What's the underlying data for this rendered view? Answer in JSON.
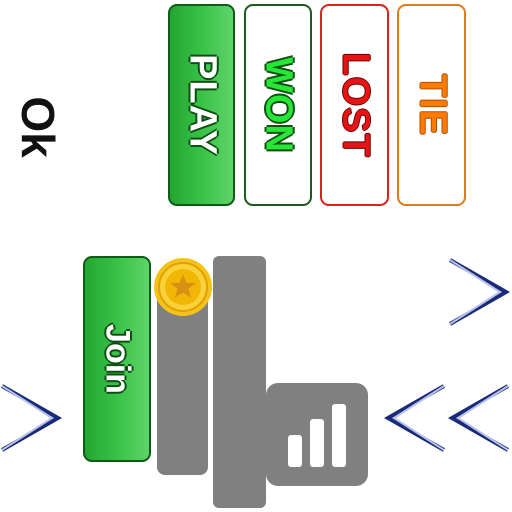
{
  "ok_label": "Ok",
  "tabs": [
    {
      "key": "play",
      "label": "PLAY"
    },
    {
      "key": "won",
      "label": "WON"
    },
    {
      "key": "lost",
      "label": "LOST"
    },
    {
      "key": "tie",
      "label": "TIE"
    }
  ],
  "join_button": {
    "label": "Join"
  },
  "icons": {
    "coin": "star-coin-icon",
    "stats": "bar-chart-icon",
    "next": "chevron-right-icon",
    "prev": "double-chevron-left-icon"
  },
  "colors": {
    "green": "#3cc44a",
    "green_dark": "#0f5c16",
    "red": "#e61414",
    "orange": "#ff7a00",
    "grey": "#808080",
    "navy": "#1a2a7a",
    "gold": "#f2b705"
  }
}
